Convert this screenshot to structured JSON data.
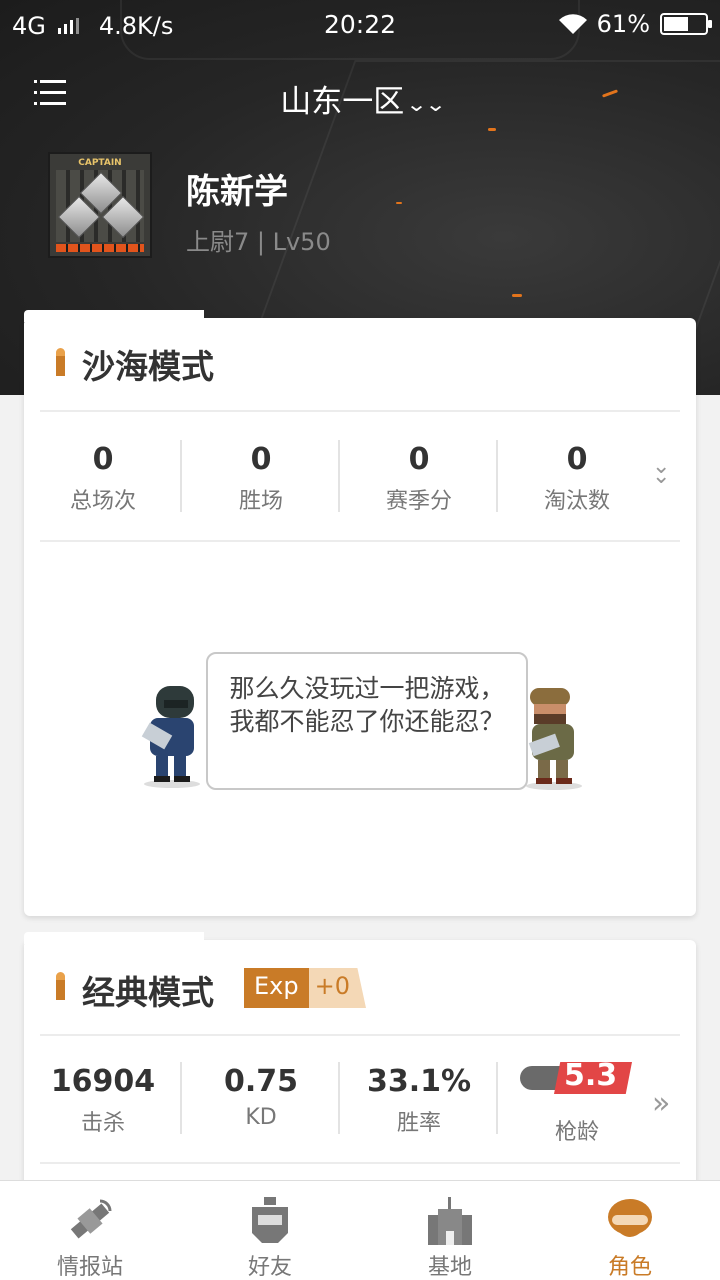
{
  "status_bar": {
    "network": "4G",
    "speed": "4.8K/s",
    "time": "20:22",
    "battery": "61%",
    "battery_level": 0.61
  },
  "header": {
    "server": "山东一区",
    "menu_icon": "menu-icon",
    "dropdown_icon": "double-chevron-down-icon"
  },
  "profile": {
    "badge_text": "CAPTAIN",
    "name": "陈新学",
    "rank_level": "上尉7 | Lv50"
  },
  "sand_mode": {
    "title": "沙海模式",
    "stats": [
      {
        "value": "0",
        "label": "总场次"
      },
      {
        "value": "0",
        "label": "胜场"
      },
      {
        "value": "0",
        "label": "赛季分"
      },
      {
        "value": "0",
        "label": "淘汰数"
      }
    ],
    "empty_message": "那么久没玩过一把游戏，我都不能忍了你还能忍？"
  },
  "classic_mode": {
    "title": "经典模式",
    "exp_label": "Exp",
    "exp_value": "+0",
    "stats": [
      {
        "value": "16904",
        "label": "击杀"
      },
      {
        "value": "0.75",
        "label": "KD"
      },
      {
        "value": "33.1%",
        "label": "胜率"
      }
    ],
    "gun_age": {
      "value": "5.3",
      "label": "枪龄"
    },
    "more_icon": "double-chevron-right-icon"
  },
  "bottom_nav": [
    {
      "label": "情报站",
      "icon": "satellite-icon"
    },
    {
      "label": "好友",
      "icon": "robot-helmet-icon"
    },
    {
      "label": "基地",
      "icon": "castle-icon"
    },
    {
      "label": "角色",
      "icon": "soldier-helmet-icon",
      "active": true
    }
  ],
  "colors": {
    "accent": "#c97b27",
    "header_bg": "#262626",
    "gun_age_red": "#e24646"
  }
}
